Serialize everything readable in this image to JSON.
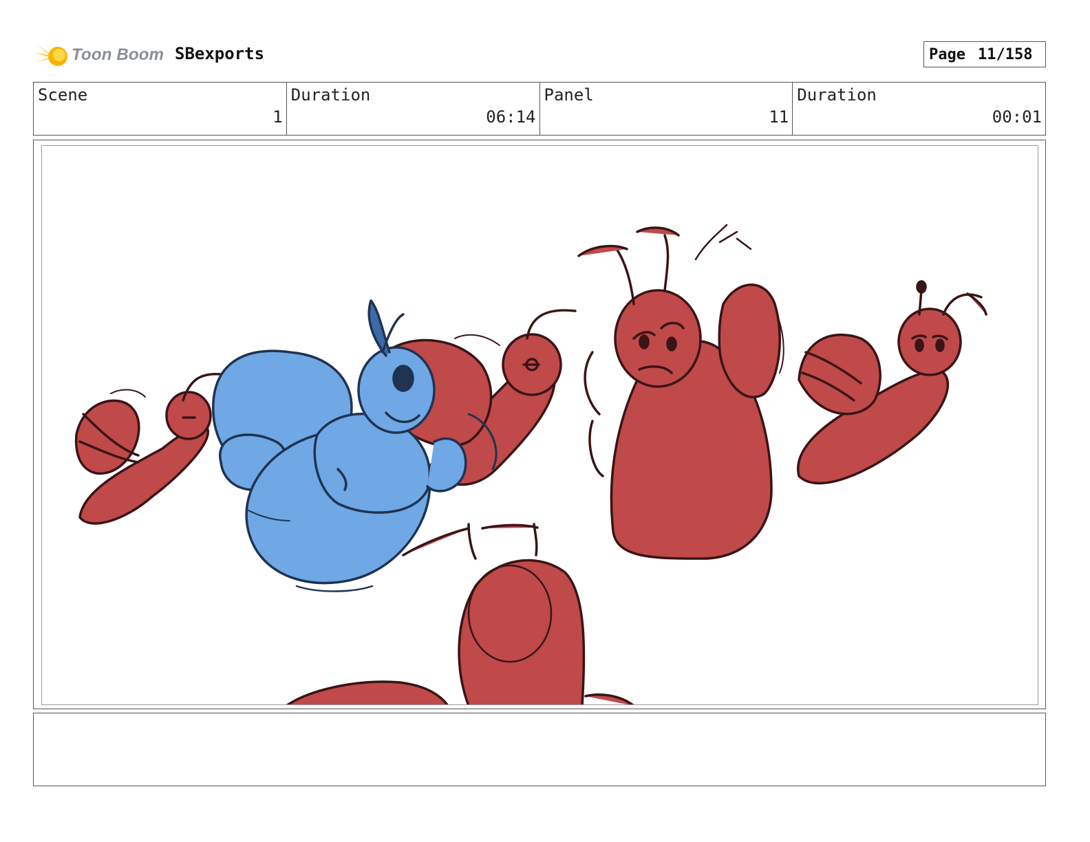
{
  "header": {
    "logo_text": "Toon Boom",
    "project_title": "SBexports",
    "page_label": "Page",
    "page_number": "11/158"
  },
  "info": {
    "scene_label": "Scene",
    "scene_value": "1",
    "scene_duration_label": "Duration",
    "scene_duration_value": "06:14",
    "panel_label": "Panel",
    "panel_value": "11",
    "panel_duration_label": "Duration",
    "panel_duration_value": "00:01"
  },
  "colors": {
    "red_character": "#c0494a",
    "blue_character": "#6fa8e4",
    "ink": "#3a1416",
    "logo_yellow": "#f5c518"
  },
  "notes": {
    "text": ""
  }
}
